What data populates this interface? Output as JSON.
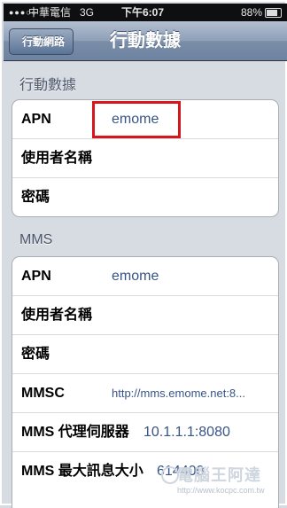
{
  "status_bar": {
    "signal": "●●●○○",
    "carrier": "中華電信",
    "network": "3G",
    "time": "下午6:07",
    "battery_percent": "88%",
    "battery_level": 0.88
  },
  "nav": {
    "back_label": "行動網路",
    "title": "行動數據"
  },
  "cellular_section": {
    "header": "行動數據",
    "rows": [
      {
        "label": "APN",
        "value": "emome"
      },
      {
        "label": "使用者名稱",
        "value": ""
      },
      {
        "label": "密碼",
        "value": ""
      }
    ]
  },
  "mms_section": {
    "header": "MMS",
    "rows": [
      {
        "label": "APN",
        "value": "emome"
      },
      {
        "label": "使用者名稱",
        "value": ""
      },
      {
        "label": "密碼",
        "value": ""
      },
      {
        "label": "MMSC",
        "value": "http://mms.emome.net:8..."
      },
      {
        "label": "MMS 代理伺服器",
        "value": "10.1.1.1:8080"
      },
      {
        "label": "MMS 最大訊息大小",
        "value": "614400"
      }
    ]
  },
  "watermark": {
    "title": "電腦王阿達",
    "url": "http://www.kocpc.com.tw"
  },
  "colors": {
    "highlight": "#d5171d",
    "value_text": "#385487"
  }
}
